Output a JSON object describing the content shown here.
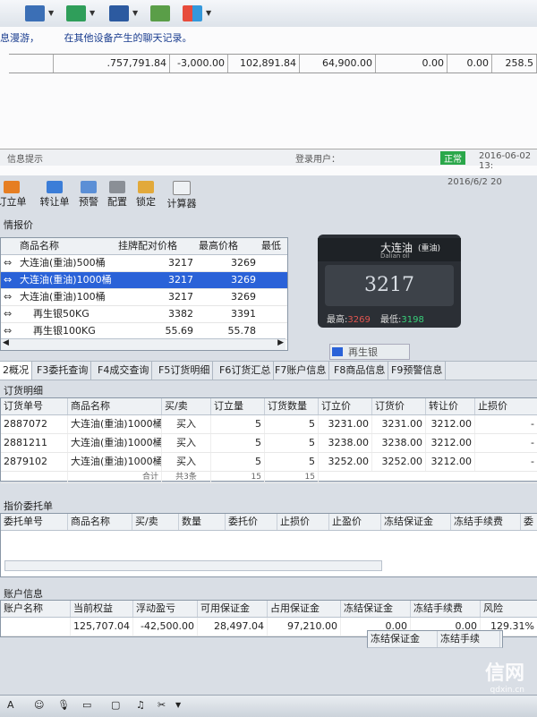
{
  "chat": {
    "notice_prefix": "息漫游，",
    "notice_text": "在其他设备产生的聊天记录。",
    "summary": [
      "",
      ".757,791.84",
      "-3,000.00",
      "102,891.84",
      "64,900.00",
      "0.00",
      "0.00",
      "258.5"
    ],
    "status_left": "信息提示",
    "status_user": "登录用户：",
    "status_badge": "正常",
    "status_time": "2016-06-02 13:"
  },
  "app": {
    "date_text": "2016/6/2 20",
    "toolbar": [
      "订立单",
      "转让单",
      "预警",
      "配置",
      "锁定",
      "计算器"
    ],
    "quote_section": "情报价",
    "quote_headers": [
      "商品名称",
      "挂牌配对价格",
      "最高价格",
      "最低"
    ],
    "quote_rows": [
      {
        "name": "大连油(重油)500桶",
        "price": "3217",
        "high": "3269"
      },
      {
        "name": "大连油(重油)1000桶",
        "price": "3217",
        "high": "3269"
      },
      {
        "name": "大连油(重油)100桶",
        "price": "3217",
        "high": "3269"
      },
      {
        "name": "再生银50KG",
        "price": "3382",
        "high": "3391"
      },
      {
        "name": "再生银100KG",
        "price": "55.69",
        "high": "55.78"
      }
    ],
    "ticker": {
      "name": "大连油",
      "tag": "(重油)",
      "sub": "Dalian oil",
      "price": "3217",
      "high_label": "最高:",
      "high": "3269",
      "low_label": "最低:",
      "low": "3198",
      "next": "再生银"
    },
    "tabs": [
      "2概况",
      "F3委托查询",
      "F4成交查询",
      "F5订货明细",
      "F6订货汇总",
      "F7账户信息",
      "F8商品信息",
      "F9预警信息"
    ],
    "orders_section": "订货明细",
    "order_headers": [
      "订货单号",
      "商品名称",
      "买/卖",
      "订立量",
      "订货数量",
      "订立价",
      "订货价",
      "转让价",
      "止损价"
    ],
    "order_rows": [
      [
        "2887072",
        "大连油(重油)1000桶",
        "买入",
        "5",
        "5",
        "3231.00",
        "3231.00",
        "3212.00",
        "-"
      ],
      [
        "2881211",
        "大连油(重油)1000桶",
        "买入",
        "5",
        "5",
        "3238.00",
        "3238.00",
        "3212.00",
        "-"
      ],
      [
        "2879102",
        "大连油(重油)1000桶",
        "买入",
        "5",
        "5",
        "3252.00",
        "3252.00",
        "3212.00",
        "-"
      ]
    ],
    "order_total": [
      "",
      "合计",
      "共3条",
      "15",
      "15",
      "",
      "",
      "",
      ""
    ],
    "limit_section": "指价委托单",
    "limit_headers": [
      "委托单号",
      "商品名称",
      "买/卖",
      "数量",
      "委托价",
      "止损价",
      "止盈价",
      "冻结保证金",
      "冻结手续费",
      "委"
    ],
    "account_section": "账户信息",
    "account_headers": [
      "账户名称",
      "当前权益",
      "浮动盈亏",
      "可用保证金",
      "占用保证金",
      "冻结保证金",
      "冻结手续费",
      "风险"
    ],
    "account_values": [
      "",
      "125,707.04",
      "-42,500.00",
      "28,497.04",
      "97,210.00",
      "0.00",
      "0.00",
      "129.31%"
    ],
    "extra_headers": [
      "冻结保证金",
      "冻结手续"
    ]
  },
  "watermark": {
    "brand": "信网",
    "site": "qdxin.cn"
  },
  "colors": {
    "selection": "#2a62d8",
    "red": "#c0392b",
    "ticker_high": "#d9534f",
    "ticker_low": "#2ecc71"
  }
}
